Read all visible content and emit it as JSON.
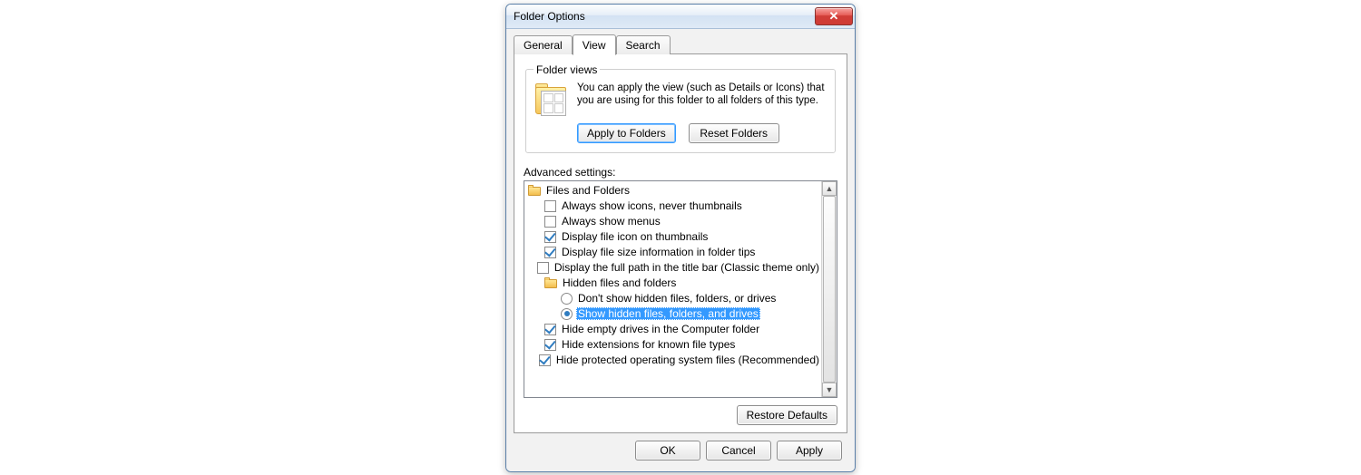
{
  "window": {
    "title": "Folder Options"
  },
  "tabs": {
    "general": "General",
    "view": "View",
    "search": "Search"
  },
  "folder_views": {
    "legend": "Folder views",
    "description": "You can apply the view (such as Details or Icons) that you are using for this folder to all folders of this type.",
    "apply_btn": "Apply to Folders",
    "reset_btn": "Reset Folders"
  },
  "advanced": {
    "label": "Advanced settings:",
    "root": "Files and Folders",
    "opt_icons": "Always show icons, never thumbnails",
    "opt_menus": "Always show menus",
    "opt_thumb_icon": "Display file icon on thumbnails",
    "opt_size_tips": "Display file size information in folder tips",
    "opt_full_path": "Display the full path in the title bar (Classic theme only)",
    "hidden_group": "Hidden files and folders",
    "radio_dont_show": "Don't show hidden files, folders, or drives",
    "radio_show": "Show hidden files, folders, and drives",
    "opt_hide_empty": "Hide empty drives in the Computer folder",
    "opt_hide_ext": "Hide extensions for known file types",
    "opt_hide_os": "Hide protected operating system files (Recommended)"
  },
  "buttons": {
    "restore": "Restore Defaults",
    "ok": "OK",
    "cancel": "Cancel",
    "apply": "Apply"
  }
}
